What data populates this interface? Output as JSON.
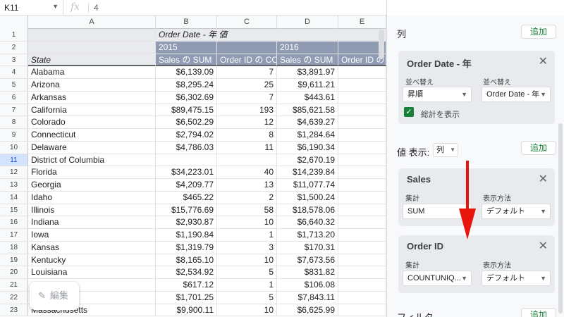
{
  "formula_bar": {
    "cell_ref": "K11",
    "fx": "fx",
    "value": "4"
  },
  "columns": [
    "A",
    "B",
    "C",
    "D",
    "E"
  ],
  "pivot_header": {
    "title": "Order Date - 年  値",
    "year1": "2015",
    "year2": "2016",
    "state_label": "State",
    "h_b": "Sales の SUM",
    "h_c": "Order ID の COUNTUNIQUE",
    "h_d": "Sales の SUM",
    "h_e": "Order ID の COUNTUNIQUE"
  },
  "rows": [
    {
      "n": "4",
      "state": "Alabama",
      "s15": "$6,139.09",
      "c15": "7",
      "s16": "$3,891.97"
    },
    {
      "n": "5",
      "state": "Arizona",
      "s15": "$8,295.24",
      "c15": "25",
      "s16": "$9,611.21"
    },
    {
      "n": "6",
      "state": "Arkansas",
      "s15": "$6,302.69",
      "c15": "7",
      "s16": "$443.61"
    },
    {
      "n": "7",
      "state": "California",
      "s15": "$89,475.15",
      "c15": "193",
      "s16": "$85,621.58"
    },
    {
      "n": "8",
      "state": "Colorado",
      "s15": "$6,502.29",
      "c15": "12",
      "s16": "$4,639.27"
    },
    {
      "n": "9",
      "state": "Connecticut",
      "s15": "$2,794.02",
      "c15": "8",
      "s16": "$1,284.64"
    },
    {
      "n": "10",
      "state": "Delaware",
      "s15": "$4,786.03",
      "c15": "11",
      "s16": "$6,190.34"
    },
    {
      "n": "11",
      "state": "District of Columbia",
      "s15": "",
      "c15": "",
      "s16": "$2,670.19"
    },
    {
      "n": "12",
      "state": "Florida",
      "s15": "$34,223.01",
      "c15": "40",
      "s16": "$14,239.84"
    },
    {
      "n": "13",
      "state": "Georgia",
      "s15": "$4,209.77",
      "c15": "13",
      "s16": "$11,077.74"
    },
    {
      "n": "14",
      "state": "Idaho",
      "s15": "$465.22",
      "c15": "2",
      "s16": "$1,500.24"
    },
    {
      "n": "15",
      "state": "Illinois",
      "s15": "$15,776.69",
      "c15": "58",
      "s16": "$18,578.06"
    },
    {
      "n": "16",
      "state": "Indiana",
      "s15": "$2,930.87",
      "c15": "10",
      "s16": "$6,640.32"
    },
    {
      "n": "17",
      "state": "Iowa",
      "s15": "$1,190.84",
      "c15": "1",
      "s16": "$1,713.20"
    },
    {
      "n": "18",
      "state": "Kansas",
      "s15": "$1,319.79",
      "c15": "3",
      "s16": "$170.31"
    },
    {
      "n": "19",
      "state": "Kentucky",
      "s15": "$8,165.10",
      "c15": "10",
      "s16": "$7,673.56"
    },
    {
      "n": "20",
      "state": "Louisiana",
      "s15": "$2,534.92",
      "c15": "5",
      "s16": "$831.82"
    },
    {
      "n": "21",
      "state": "",
      "s15": "$617.12",
      "c15": "1",
      "s16": "$106.08"
    },
    {
      "n": "22",
      "state": "",
      "s15": "$1,701.25",
      "c15": "5",
      "s16": "$7,843.11"
    },
    {
      "n": "23",
      "state": "Massachusetts",
      "s15": "$9,900.11",
      "c15": "10",
      "s16": "$6,625.99"
    }
  ],
  "edit_button": "編集",
  "panel": {
    "columns_label": "列",
    "add": "追加",
    "order_card": {
      "title": "Order Date - 年",
      "sort_label": "並べ替え",
      "sort_by_label": "並べ替え",
      "sort_value": "昇順",
      "sort_by_value": "Order Date - 年",
      "show_totals": "総計を表示"
    },
    "values_label": "値 表示:",
    "values_display": "列",
    "sales_card": {
      "title": "Sales",
      "agg_label": "集計",
      "show_as_label": "表示方法",
      "agg_value": "SUM",
      "show_as_value": "デフォルト"
    },
    "orderid_card": {
      "title": "Order ID",
      "agg_label": "集計",
      "show_as_label": "表示方法",
      "agg_value": "COUNTUNIQ...",
      "show_as_value": "デフォルト"
    },
    "filter_label": "フィルタ"
  },
  "colors": {
    "accent_green": "#188038",
    "arrow_red": "#e8150f",
    "pivot_header_dark": "#8e9bb3"
  }
}
